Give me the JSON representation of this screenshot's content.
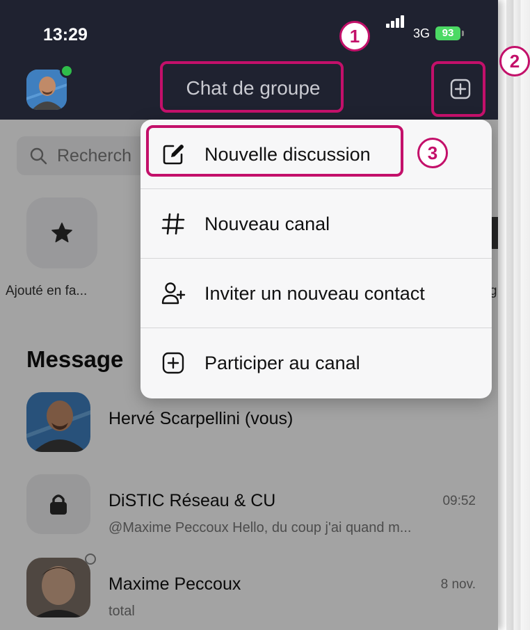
{
  "status_bar": {
    "time": "13:29",
    "network": "3G",
    "battery": "93"
  },
  "header": {
    "title": "Chat de groupe",
    "new_button_icon": "plus-square-icon"
  },
  "search": {
    "placeholder": "Recherch"
  },
  "favorites": {
    "label": "Ajouté en fa...",
    "edge_label": "g"
  },
  "messages": {
    "section_title": "Message",
    "items": [
      {
        "name": "Hervé Scarpellini (vous)",
        "time": "",
        "preview": ""
      },
      {
        "name": "DiSTIC Réseau & CU",
        "time": "09:52",
        "preview": "@Maxime Peccoux Hello, du coup j'ai quand m..."
      },
      {
        "name": "Maxime Peccoux",
        "time": "8 nov.",
        "preview": "total"
      }
    ]
  },
  "menu": {
    "items": [
      {
        "label": "Nouvelle discussion",
        "icon": "compose-icon"
      },
      {
        "label": "Nouveau canal",
        "icon": "hash-icon"
      },
      {
        "label": "Inviter un nouveau contact",
        "icon": "add-person-icon"
      },
      {
        "label": "Participer au canal",
        "icon": "plus-square-icon"
      }
    ]
  },
  "annotations": {
    "badge_1": "1",
    "badge_2": "2",
    "badge_3": "3",
    "highlight_color": "#c3106a"
  }
}
